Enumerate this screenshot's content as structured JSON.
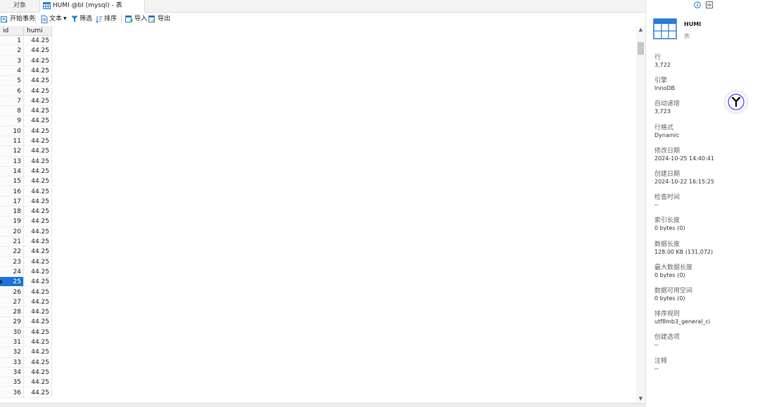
{
  "tabs": {
    "objects": "对象",
    "table": "HUMI @bl (mysql) - 表"
  },
  "toolbar": {
    "begin_transaction": "开始事务",
    "text": "文本",
    "filter": "筛选",
    "sort": "排序",
    "import": "导入",
    "export": "导出"
  },
  "grid": {
    "columns": [
      "id",
      "humi"
    ],
    "rows": [
      [
        "1",
        "44.25"
      ],
      [
        "2",
        "44.25"
      ],
      [
        "3",
        "44.25"
      ],
      [
        "4",
        "44.25"
      ],
      [
        "5",
        "44.25"
      ],
      [
        "6",
        "44.25"
      ],
      [
        "7",
        "44.25"
      ],
      [
        "8",
        "44.25"
      ],
      [
        "9",
        "44.25"
      ],
      [
        "10",
        "44.25"
      ],
      [
        "11",
        "44.25"
      ],
      [
        "12",
        "44.25"
      ],
      [
        "13",
        "44.25"
      ],
      [
        "14",
        "44.25"
      ],
      [
        "15",
        "44.25"
      ],
      [
        "16",
        "44.25"
      ],
      [
        "17",
        "44.25"
      ],
      [
        "18",
        "44.25"
      ],
      [
        "19",
        "44.25"
      ],
      [
        "20",
        "44.25"
      ],
      [
        "21",
        "44.25"
      ],
      [
        "22",
        "44.25"
      ],
      [
        "23",
        "44.25"
      ],
      [
        "24",
        "44.25"
      ],
      [
        "25",
        "44.25"
      ],
      [
        "26",
        "44.25"
      ],
      [
        "27",
        "44.25"
      ],
      [
        "28",
        "44.25"
      ],
      [
        "29",
        "44.25"
      ],
      [
        "30",
        "44.25"
      ],
      [
        "31",
        "44.25"
      ],
      [
        "32",
        "44.25"
      ],
      [
        "33",
        "44.25"
      ],
      [
        "34",
        "44.25"
      ],
      [
        "35",
        "44.25"
      ],
      [
        "36",
        "44.25"
      ]
    ],
    "selected_row": 25
  },
  "panel": {
    "object_name": "HUMI",
    "object_type": "表",
    "properties": [
      {
        "label": "行",
        "value": "3,722"
      },
      {
        "label": "引擎",
        "value": "InnoDB"
      },
      {
        "label": "自动递增",
        "value": "3,723"
      },
      {
        "label": "行格式",
        "value": "Dynamic"
      },
      {
        "label": "修改日期",
        "value": "2024-10-25 14:40:41"
      },
      {
        "label": "创建日期",
        "value": "2024-10-22 16:15:25"
      },
      {
        "label": "检查时间",
        "value": "--"
      },
      {
        "label": "索引长度",
        "value": "0 bytes (0)"
      },
      {
        "label": "数据长度",
        "value": "128.00 KB (131,072)"
      },
      {
        "label": "最大数据长度",
        "value": "0 bytes (0)"
      },
      {
        "label": "数据可用空间",
        "value": "0 bytes (0)"
      },
      {
        "label": "排序规则",
        "value": "utf8mb3_general_ci"
      },
      {
        "label": "创建选项",
        "value": "--"
      },
      {
        "label": "注释",
        "value": "--"
      }
    ]
  },
  "colors": {
    "accent": "#1a73d9",
    "table_icon": "#2b7cd3"
  }
}
